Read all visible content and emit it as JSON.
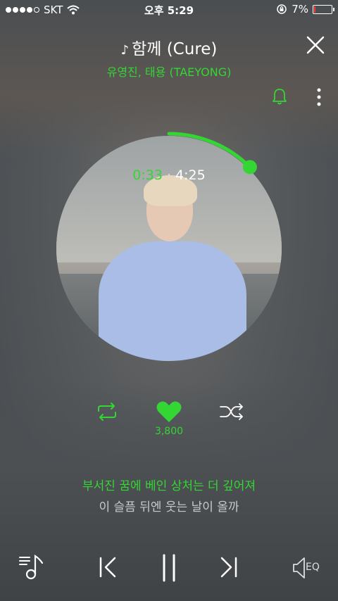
{
  "status_bar": {
    "carrier": "SKT",
    "time": "오후 5:29",
    "battery": "7%",
    "battery_level": 0.07,
    "signal_bars": 4,
    "signal_max": 5
  },
  "player": {
    "title": "함께 (Cure)",
    "artist": "유영진, 태용 (TAEYONG)",
    "elapsed": "0:33",
    "duration": "4:25",
    "like_count": "3,800",
    "accent_color": "#33d633"
  },
  "lyrics": {
    "current": "부서진 꿈에 베인 상처는 더 깊어져",
    "next": "이 슬픔 뒤엔 웃는 날이 올까"
  },
  "controls": {
    "eq_label": "EQ"
  }
}
